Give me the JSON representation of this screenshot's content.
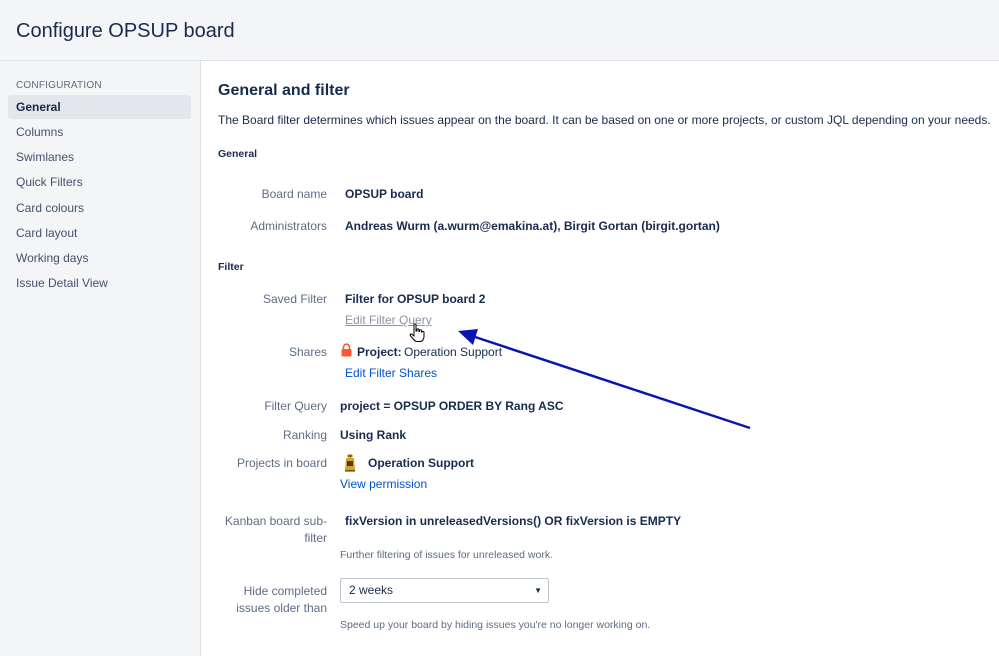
{
  "header": {
    "title": "Configure OPSUP board"
  },
  "sidebar": {
    "heading": "CONFIGURATION",
    "items": [
      {
        "label": "General",
        "active": true
      },
      {
        "label": "Columns"
      },
      {
        "label": "Swimlanes"
      },
      {
        "label": "Quick Filters"
      },
      {
        "label": "Card colours"
      },
      {
        "label": "Card layout"
      },
      {
        "label": "Working days"
      },
      {
        "label": "Issue Detail View"
      }
    ]
  },
  "main": {
    "title": "General and filter",
    "intro": "The Board filter determines which issues appear on the board. It can be based on one or more projects, or custom JQL depending on your needs.",
    "general_heading": "General",
    "board_name_label": "Board name",
    "board_name_value": "OPSUP board",
    "administrators_label": "Administrators",
    "administrators_value": "Andreas Wurm (a.wurm@emakina.at), Birgit Gortan (birgit.gortan)",
    "filter_heading": "Filter",
    "saved_filter_label": "Saved Filter",
    "saved_filter_value": "Filter for OPSUP board 2",
    "edit_filter_query": "Edit Filter Query",
    "shares_label": "Shares",
    "shares_project_label": "Project:",
    "shares_project_value": "Operation Support",
    "edit_filter_shares": "Edit Filter Shares",
    "filter_query_label": "Filter Query",
    "filter_query_value": "project = OPSUP ORDER BY Rang ASC",
    "ranking_label": "Ranking",
    "ranking_value": "Using Rank",
    "projects_label": "Projects in board",
    "projects_value": "Operation Support",
    "view_permission": "View permission",
    "kanban_label": "Kanban board sub-filter",
    "kanban_value": "fixVersion in unreleasedVersions() OR fixVersion is EMPTY",
    "kanban_desc": "Further filtering of issues for unreleased work.",
    "hide_label": "Hide completed issues older than",
    "hide_value": "2 weeks",
    "hide_desc": "Speed up your board by hiding issues you're no longer working on."
  },
  "colors": {
    "accent_link": "#0052cc",
    "annotation_arrow": "#0a14b4",
    "lock": "#ff5630"
  },
  "icons": {
    "lock": "lock-icon",
    "project": "project-avatar-icon",
    "caret": "chevron-down-icon",
    "cursor": "hand-cursor-icon"
  }
}
